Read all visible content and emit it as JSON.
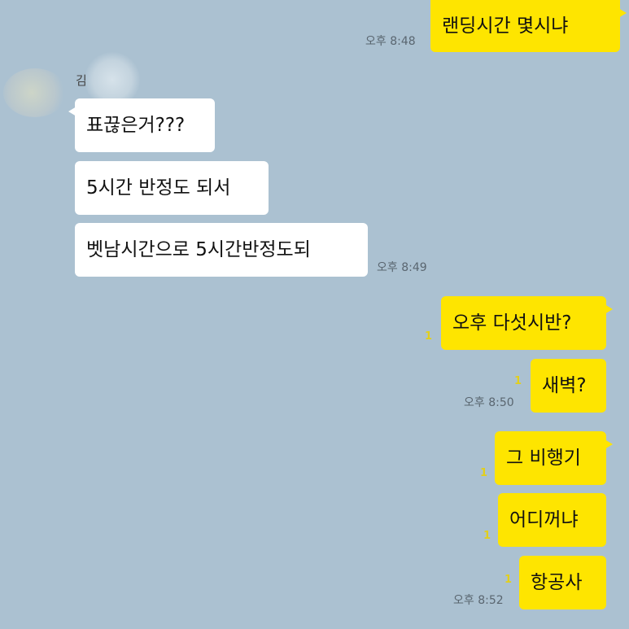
{
  "messages": [
    {
      "text": "랜딩시간 몇시냐"
    },
    {
      "text": "표끊은거???"
    },
    {
      "text": "5시간 반정도 되서"
    },
    {
      "text": "벳남시간으로 5시간반정도되"
    },
    {
      "text": "오후 다섯시반?"
    },
    {
      "text": "새벽?"
    },
    {
      "text": "그 비행기"
    },
    {
      "text": "어디꺼냐"
    },
    {
      "text": "항공사"
    }
  ],
  "times": [
    "오후 8:48",
    "오후 8:49",
    "오후 8:50",
    "오후 8:52"
  ],
  "unread": "1",
  "sender_name": "김",
  "colors": {
    "background": "#abc1d1",
    "my_bubble": "#fee500",
    "their_bubble": "#ffffff",
    "unread_count": "#e2cf1b"
  }
}
